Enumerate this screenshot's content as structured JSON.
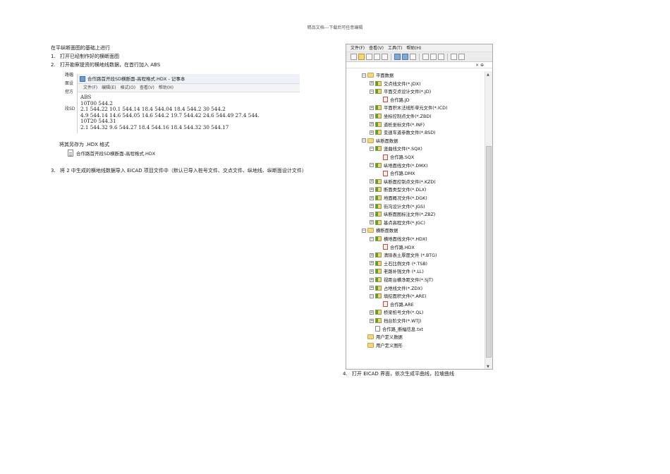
{
  "header_note": "精品文档---下载后可任意编辑",
  "intro": "在平纵断面图的基础上进行",
  "steps": [
    {
      "num": "1.",
      "text": "打开已经制作好的横断面图"
    },
    {
      "num": "2.",
      "text": "打开勘察提资的横地线数据，在首行加入 ABS"
    },
    {
      "num": "3.",
      "text": "将 2 中生成的横地线数据导入 EICAD 项目文件中（默认已导入桩号文件、交点文件、纵地线、纵断面设计文件）"
    },
    {
      "num": "4.",
      "text": "打开 EICAD 界面，依次生成平曲线，拉坡曲线"
    }
  ],
  "behind_labels": [
    "路幅",
    "面设",
    "挖方",
    "",
    "段SD"
  ],
  "notepad": {
    "title": "合作路首开段SD横断面-高程格式.HDX - 记事本",
    "menu": [
      "文件(F)",
      "编辑(E)",
      "格式(O)",
      "查看(V)",
      "帮助(H)"
    ],
    "lines": [
      "ABS",
      "10T00 544.2",
      "2.1 544.22 10.1 544.14 18.4 544.04 18.4 544.2 30 544.2",
      "4.9 544.14 14.6 544.05 14.6 544.2 19.7 544.42 24.6 544.49 27.4 544.",
      "10T20 544.31",
      "2.1 544.32 9.6 544.27 18.4 544.16 18.4 544.32 30 544.17"
    ]
  },
  "save_as": "将其另存为  .HDX 格式",
  "hdx_file": "合作路首开段SD横断面-高程格式.HDX",
  "app": {
    "menu": [
      "文件(F)",
      "查看(V)",
      "工具(T)",
      "帮助(H)"
    ],
    "panel_head": "× ⊕",
    "tree": [
      {
        "level": 0,
        "expander": "−",
        "icon": "folder",
        "label": "平面数据"
      },
      {
        "level": 1,
        "expander": "+",
        "icon": "gfolder",
        "label": "交点线文件(*.JDX)"
      },
      {
        "level": 1,
        "expander": "−",
        "icon": "gfolder",
        "label": "平面交点设计文件(*.JD)"
      },
      {
        "level": 2,
        "expander": "",
        "icon": "file",
        "label": "合作路.JD"
      },
      {
        "level": 1,
        "expander": "+",
        "icon": "gfolder",
        "label": "平面积木法线形单元文件(*.ICD)"
      },
      {
        "level": 1,
        "expander": "+",
        "icon": "gfolder",
        "label": "坐标控制点文件(*.ZBD)"
      },
      {
        "level": 1,
        "expander": "+",
        "icon": "gfolder",
        "label": "道桩坐标文件(*.INF)"
      },
      {
        "level": 1,
        "expander": "+",
        "icon": "gfolder",
        "label": "变速车道参数文件(*.BSD)"
      },
      {
        "level": 0,
        "expander": "−",
        "icon": "folder",
        "label": "纵断面数据"
      },
      {
        "level": 1,
        "expander": "−",
        "icon": "gfolder",
        "label": "竖曲线文件(*.SQX)"
      },
      {
        "level": 2,
        "expander": "",
        "icon": "file",
        "label": "合作路.SQX"
      },
      {
        "level": 1,
        "expander": "−",
        "icon": "gfolder",
        "label": "纵地面线文件(*.DMX)"
      },
      {
        "level": 2,
        "expander": "",
        "icon": "file",
        "label": "合作路.DMX"
      },
      {
        "level": 1,
        "expander": "+",
        "icon": "gfolder",
        "label": "纵断面控制点文件(*.KZD)"
      },
      {
        "level": 1,
        "expander": "+",
        "icon": "gfolder",
        "label": "断面类型文件(*.DLX)"
      },
      {
        "level": 1,
        "expander": "+",
        "icon": "gfolder",
        "label": "地面概况文件(*.DGK)"
      },
      {
        "level": 1,
        "expander": "+",
        "icon": "gfolder",
        "label": "街沟设计文件(*.JGS)"
      },
      {
        "level": 1,
        "expander": "+",
        "icon": "gfolder",
        "label": "纵断面图标注文件(*.ZBZ)"
      },
      {
        "level": 1,
        "expander": "+",
        "icon": "gfolder",
        "label": "基点高程文件(*.JGC)"
      },
      {
        "level": 0,
        "expander": "−",
        "icon": "folder",
        "label": "横断面数据"
      },
      {
        "level": 1,
        "expander": "−",
        "icon": "gfolder",
        "label": "横地面线文件(*.HDX)"
      },
      {
        "level": 2,
        "expander": "",
        "icon": "file",
        "label": "合作路.HDX"
      },
      {
        "level": 1,
        "expander": "+",
        "icon": "gfolder",
        "label": "清除表土厚度文件 (*.BTG)"
      },
      {
        "level": 1,
        "expander": "+",
        "icon": "gfolder",
        "label": "土石比例文件 (*.TSB)"
      },
      {
        "level": 1,
        "expander": "+",
        "icon": "gfolder",
        "label": "老路补强文件 (*.LL)"
      },
      {
        "level": 1,
        "expander": "+",
        "icon": "gfolder",
        "label": "视距台横净距文件(*.SJT)"
      },
      {
        "level": 1,
        "expander": "+",
        "icon": "gfolder",
        "label": "占地线文件(*.ZDX)"
      },
      {
        "level": 1,
        "expander": "−",
        "icon": "gfolder",
        "label": "填挖面积文件(*.ARE)"
      },
      {
        "level": 2,
        "expander": "",
        "icon": "file",
        "label": "合作路.ARE"
      },
      {
        "level": 1,
        "expander": "+",
        "icon": "gfolder",
        "label": "桥梁桩号文件(*.QL)"
      },
      {
        "level": 1,
        "expander": "+",
        "icon": "gfolder",
        "label": "挡台阶文件(*.WTJ)"
      },
      {
        "level": 1,
        "expander": "",
        "icon": "txt",
        "label": "合作路_断幅信息.txt"
      },
      {
        "level": 0,
        "expander": "",
        "icon": "folder",
        "label": "用户定义数据"
      },
      {
        "level": 0,
        "expander": "",
        "icon": "folder",
        "label": "用户定义图形"
      }
    ]
  }
}
